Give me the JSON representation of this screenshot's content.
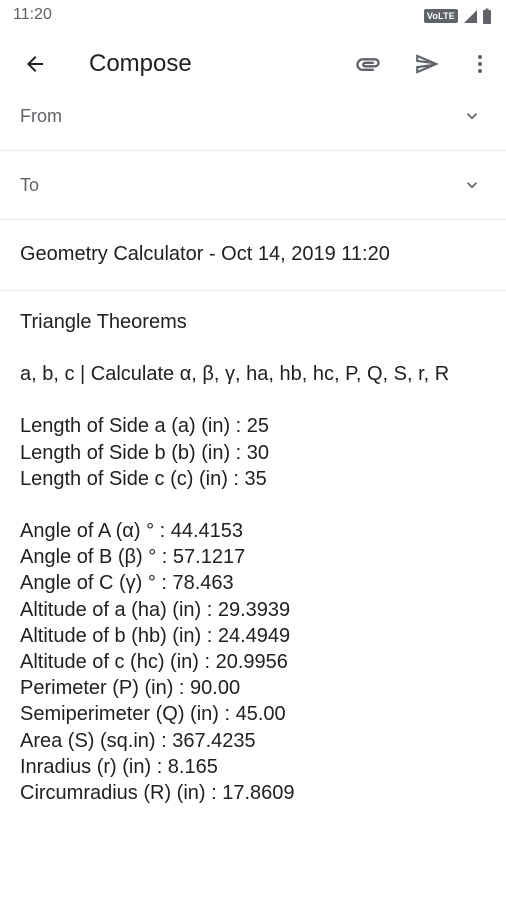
{
  "status": {
    "time": "11:20",
    "network_badge": "VoLTE"
  },
  "appbar": {
    "title": "Compose",
    "back_icon": "arrow-back-icon",
    "attach_icon": "paperclip-icon",
    "send_icon": "send-icon",
    "more_icon": "more-vert-icon"
  },
  "fields": {
    "from_label": "From",
    "to_label": "To",
    "subject": "Geometry Calculator - Oct 14, 2019 11:20"
  },
  "body": {
    "heading": "Triangle Theorems",
    "calc_line": "a, b, c | Calculate α, β, γ, ha, hb, hc, P, Q, S, r, R",
    "inputs": [
      "Length of Side a (a) (in) : 25",
      "Length of Side b (b) (in) : 30",
      "Length of Side c (c) (in) : 35"
    ],
    "results": [
      "Angle of A (α) ° : 44.4153",
      "Angle of B (β) ° : 57.1217",
      "Angle of C (γ) ° : 78.463",
      "Altitude of a (ha) (in) : 29.3939",
      "Altitude of b (hb) (in) : 24.4949",
      "Altitude of c (hc) (in) : 20.9956",
      "Perimeter (P) (in) : 90.00",
      "Semiperimeter (Q) (in) : 45.00",
      "Area (S) (sq.in) : 367.4235",
      "Inradius (r) (in) : 8.165",
      "Circumradius (R) (in) : 17.8609"
    ]
  },
  "colors": {
    "text": "#202124",
    "muted": "#5f6368",
    "divider": "#e8eaed"
  }
}
